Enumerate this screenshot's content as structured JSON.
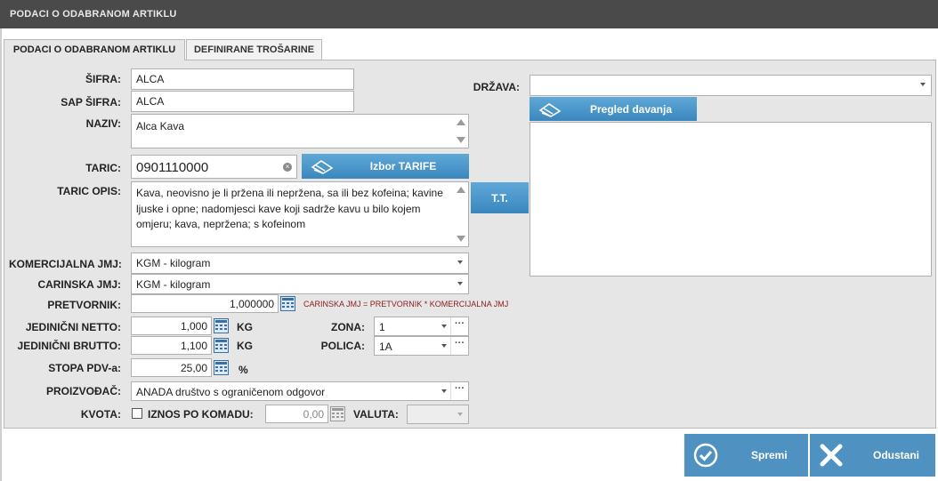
{
  "window": {
    "title": "PODACI O ODABRANOM ARTIKLU"
  },
  "tabs": [
    {
      "label": "PODACI O ODABRANOM ARTIKLU",
      "active": true
    },
    {
      "label": "DEFINIRANE TROŠARINE",
      "active": false
    }
  ],
  "form": {
    "sifra": {
      "label": "ŠIFRA:",
      "value": "ALCA"
    },
    "sap_sifra": {
      "label": "SAP ŠIFRA:",
      "value": "ALCA"
    },
    "naziv": {
      "label": "NAZIV:",
      "value": "Alca Kava"
    },
    "taric": {
      "label": "TARIC:",
      "value": "0901110000"
    },
    "izbor_tarife_button": "Izbor TARIFE",
    "taric_opis": {
      "label": "TARIC OPIS:",
      "value": "Kava, neovisno je li pržena ili nepržena, sa ili bez kofeina; kavine ljuske i opne; nadomjesci kave koji sadrže kavu u bilo kojem omjeru; kava, nepržena; s kofeinom"
    },
    "tt_button": "T.T.",
    "komercijalna_jmj": {
      "label": "KOMERCIJALNA JMJ:",
      "value": "KGM - kilogram"
    },
    "carinska_jmj": {
      "label": "CARINSKA JMJ:",
      "value": "KGM - kilogram"
    },
    "pretvornik": {
      "label": "PRETVORNIK:",
      "value": "1,000000",
      "note": "CARINSKA JMJ = PRETVORNIK * KOMERCIJALNA JMJ"
    },
    "jedinicni_netto": {
      "label": "JEDINIČNI NETTO:",
      "value": "1,000",
      "unit": "KG"
    },
    "jedinicni_brutto": {
      "label": "JEDINIČNI BRUTTO:",
      "value": "1,100",
      "unit": "KG"
    },
    "stopa_pdv": {
      "label": "STOPA PDV-a:",
      "value": "25,00",
      "unit": "%"
    },
    "zona": {
      "label": "ZONA:",
      "value": "1"
    },
    "polica": {
      "label": "POLICA:",
      "value": "1A"
    },
    "proizvodac": {
      "label": "PROIZVOĐAČ:",
      "value": "ANADA društvo s ograničenom odgovor"
    },
    "kvota": {
      "label": "KVOTA:",
      "checked": false
    },
    "iznos_po_komadu": {
      "label": "IZNOS PO KOMADU:",
      "value": "0,00"
    },
    "valuta": {
      "label": "VALUTA:",
      "value": ""
    },
    "drzava": {
      "label": "DRŽAVA:",
      "value": ""
    },
    "pregled_davanja_button": "Pregled davanja",
    "dots": "···"
  },
  "footer": {
    "save_label": "Spremi",
    "cancel_label": "Odustani"
  },
  "colors": {
    "accent": "#4f92c2",
    "titlebar": "#4a4a4a",
    "panel": "#e6e6e6",
    "note": "#8b1c1c"
  }
}
